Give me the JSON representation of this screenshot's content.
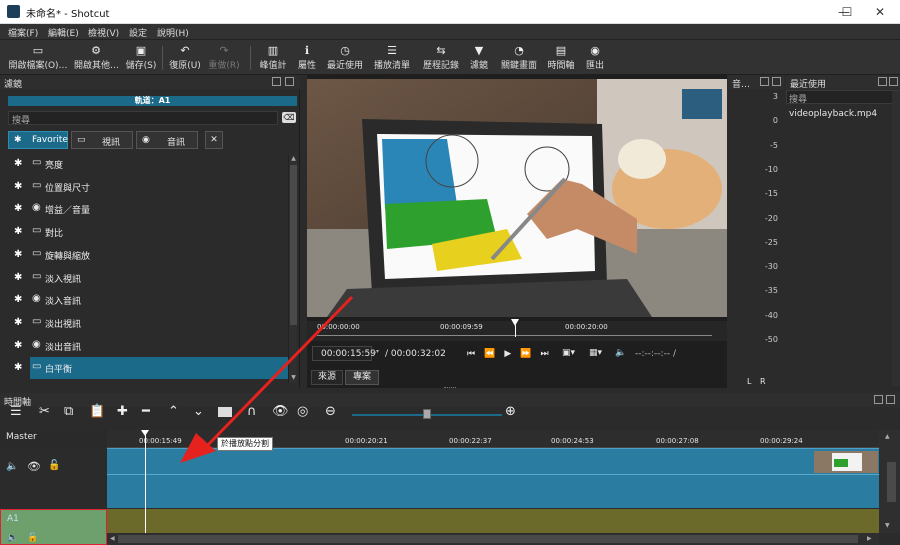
{
  "window": {
    "title": "未命名* - Shotcut",
    "minimize": "—",
    "maximize": "☐",
    "close": "✕"
  },
  "menu": [
    "檔案(F)",
    "編輯(E)",
    "檢視(V)",
    "設定",
    "說明(H)"
  ],
  "toolbar": [
    {
      "icon": "folder-open-icon",
      "glyph": "▭",
      "label": "開啟檔案(O)…"
    },
    {
      "icon": "open-other-icon",
      "glyph": "⚙",
      "label": "開啟其他…"
    },
    {
      "icon": "save-icon",
      "glyph": "▣",
      "label": "儲存(S)"
    },
    {
      "icon": "undo-icon",
      "glyph": "↶",
      "label": "復原(U)"
    },
    {
      "icon": "redo-icon",
      "glyph": "↷",
      "label": "重做(R)"
    },
    {
      "icon": "peak-meter-icon",
      "glyph": "▥",
      "label": "峰值計"
    },
    {
      "icon": "info-icon",
      "glyph": "ℹ",
      "label": "屬性"
    },
    {
      "icon": "clock-icon",
      "glyph": "◷",
      "label": "最近使用"
    },
    {
      "icon": "playlist-icon",
      "glyph": "☰",
      "label": "播放清單"
    },
    {
      "icon": "history-icon",
      "glyph": "⇆",
      "label": "歷程記錄"
    },
    {
      "icon": "filter-icon",
      "glyph": "▼",
      "label": "濾鏡"
    },
    {
      "icon": "keyframes-icon",
      "glyph": "◔",
      "label": "關鍵畫面"
    },
    {
      "icon": "timeline-icon",
      "glyph": "▤",
      "label": "時間軸"
    },
    {
      "icon": "export-icon",
      "glyph": "◉",
      "label": "匯出"
    }
  ],
  "filters": {
    "panel_title": "濾鏡",
    "track_label": "軌道：A1",
    "search_placeholder": "搜尋",
    "tabs": [
      {
        "label": "Favorite",
        "glyph": "✱"
      },
      {
        "label": "視訊",
        "glyph": "▭"
      },
      {
        "label": "音訊",
        "glyph": "◉"
      }
    ],
    "close_tab": "✕",
    "items": [
      {
        "label": "亮度",
        "type": "video"
      },
      {
        "label": "位置與尺寸",
        "type": "video"
      },
      {
        "label": "增益／音量",
        "type": "audio"
      },
      {
        "label": "對比",
        "type": "video"
      },
      {
        "label": "旋轉與縮放",
        "type": "video"
      },
      {
        "label": "淡入視訊",
        "type": "video"
      },
      {
        "label": "淡入音訊",
        "type": "audio"
      },
      {
        "label": "淡出視訊",
        "type": "video"
      },
      {
        "label": "淡出音訊",
        "type": "audio"
      },
      {
        "label": "白平衡",
        "type": "video",
        "selected": true
      }
    ]
  },
  "player": {
    "ruler": [
      "00:00:00:00",
      "00:00:09:59",
      "00:00:20:00"
    ],
    "current_time": "00:00:15:59",
    "duration": "/ 00:00:32:02",
    "in_out": "--:--:--:-- /",
    "tabs": [
      "來源",
      "專案"
    ]
  },
  "audio_meter": {
    "title": "音…",
    "scale": [
      "3",
      "0",
      "-5",
      "-10",
      "-15",
      "-20",
      "-25",
      "-30",
      "-35",
      "-40",
      "-50"
    ],
    "channels": [
      "L",
      "R"
    ]
  },
  "recent": {
    "title": "最近使用",
    "search_placeholder": "搜尋",
    "items": [
      "videoplayback.mp4"
    ]
  },
  "timeline": {
    "title": "時間軸",
    "master_label": "Master",
    "ruler": [
      "00:00:15:49",
      "00:00:20:21",
      "00:00:22:37",
      "00:00:24:53",
      "00:00:27:08",
      "00:00:29:24"
    ],
    "tooltip": "於播放點分割",
    "track_a1": "A1",
    "zoom_level": 0.5
  },
  "colors": {
    "accent": "#1b6a8a",
    "clip": "#2a7ca0",
    "audio_clip": "#6b6a2a",
    "arrow": "#e5221d",
    "selected_track": "#6ea06e"
  }
}
